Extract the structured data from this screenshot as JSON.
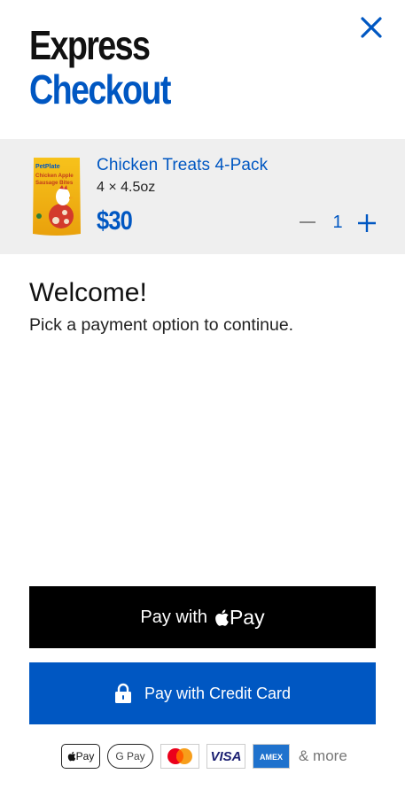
{
  "header": {
    "title_line1": "Express",
    "title_line2": "Checkout"
  },
  "cart": {
    "product_name": "Chicken Treats 4-Pack",
    "product_size": "4 × 4.5oz",
    "price": "$30",
    "quantity": "1",
    "package_brand": "PetPlate",
    "package_name": "Chicken Apple Sausage Bites"
  },
  "welcome": {
    "heading": "Welcome!",
    "subtitle": "Pick a payment option to continue."
  },
  "buttons": {
    "apple_pay_label": "Pay with",
    "apple_pay_mark": "Pay",
    "credit_card_label": "Pay with Credit Card"
  },
  "payment_methods": {
    "apple_pay": "Pay",
    "google_pay": "G Pay",
    "visa": "VISA",
    "amex": "AMEX",
    "more": "& more"
  },
  "colors": {
    "brand_blue": "#0057c2",
    "cart_bg": "#efefef",
    "apple_button": "#000000"
  }
}
